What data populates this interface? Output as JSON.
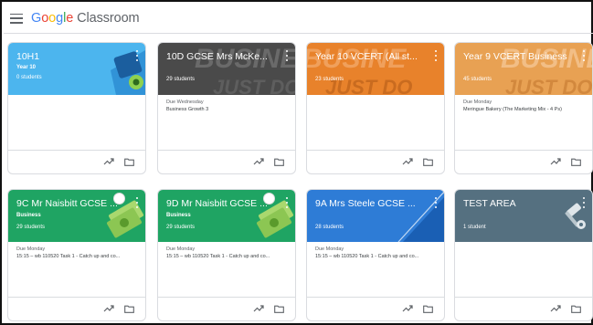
{
  "app": {
    "brand_google": "Google",
    "brand_product": " Classroom"
  },
  "colors": {
    "light_blue": "#4cb5ee",
    "dark_gray": "#4a4a4a",
    "orange": "#e8822b",
    "light_orange": "#e8a153",
    "green": "#1fa463",
    "blue": "#2e7cd6",
    "slate": "#557080"
  },
  "cards": [
    {
      "title": "10H1",
      "subtitle": "Year 10",
      "students": "0 students",
      "due": "",
      "task": ""
    },
    {
      "title": "10D GCSE Mrs McKe...",
      "subtitle": "",
      "students": "29 students",
      "due": "Due Wednesday",
      "task": "Business Growth 3"
    },
    {
      "title": "Year 10 VCERT (All st...",
      "subtitle": "",
      "students": "23 students",
      "due": "",
      "task": ""
    },
    {
      "title": "Year 9 VCERT Business",
      "subtitle": "",
      "students": "45 students",
      "due": "Due Monday",
      "task": "Meringue Bakery (The Marketing Mix - 4 Ps)"
    },
    {
      "title": "9C Mr Naisbitt GCSE ...",
      "subtitle": "Business",
      "students": "29 students",
      "due": "Due Monday",
      "task": "15:15 – wb 110520 Task 1 - Catch up and co..."
    },
    {
      "title": "9D Mr Naisbitt GCSE ...",
      "subtitle": "Business",
      "students": "29 students",
      "due": "Due Monday",
      "task": "15:15 – wb 110520 Task 1 - Catch up and co..."
    },
    {
      "title": "9A Mrs Steele GCSE ...",
      "subtitle": "",
      "students": "28 students",
      "due": "Due Monday",
      "task": "15:15 – wb 110520 Task 1 - Catch up and co..."
    },
    {
      "title": "TEST AREA",
      "subtitle": "",
      "students": "1 student",
      "due": "",
      "task": ""
    }
  ],
  "icons": {
    "menu": "hamburger-menu-icon",
    "more": "more-vert-icon",
    "trend": "trending-up-icon",
    "folder": "folder-icon"
  }
}
